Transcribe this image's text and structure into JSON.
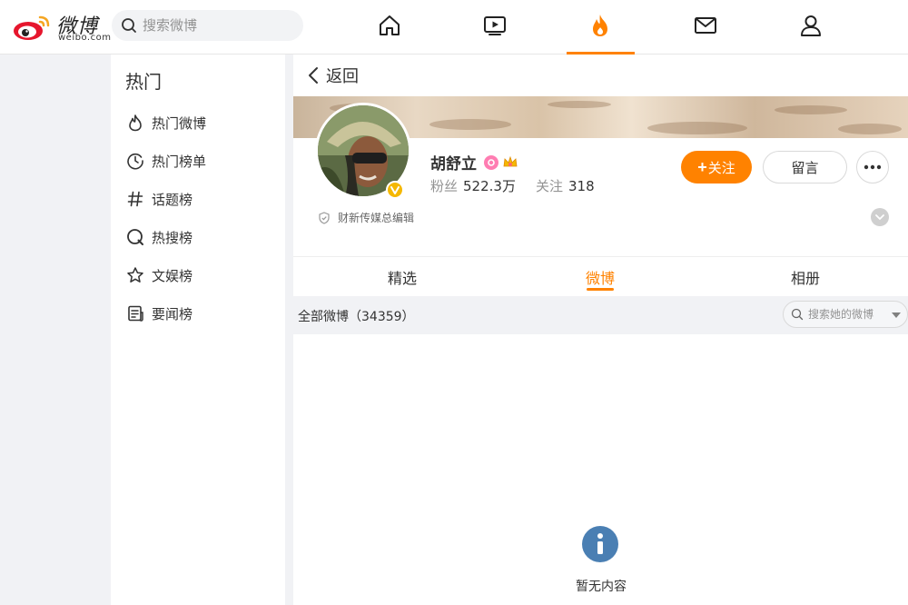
{
  "header": {
    "logo_brand": "微博",
    "logo_domain": "weibo.com",
    "search_placeholder": "搜索微博",
    "nav": [
      {
        "name": "home-icon"
      },
      {
        "name": "video-icon"
      },
      {
        "name": "hot-fire-icon",
        "active": true
      },
      {
        "name": "mail-icon"
      },
      {
        "name": "profile-icon"
      }
    ]
  },
  "sidebar": {
    "title": "热门",
    "items": [
      {
        "label": "热门微博",
        "icon": "flame-outline-icon"
      },
      {
        "label": "热门榜单",
        "icon": "clock-icon"
      },
      {
        "label": "话题榜",
        "icon": "hashtag-icon"
      },
      {
        "label": "热搜榜",
        "icon": "search-circle-icon"
      },
      {
        "label": "文娱榜",
        "icon": "star-icon"
      },
      {
        "label": "要闻榜",
        "icon": "news-icon"
      }
    ]
  },
  "main": {
    "back_label": "返回",
    "profile": {
      "name": "胡舒立",
      "fans_label": "粉丝",
      "fans_value": "522.3万",
      "following_label": "关注",
      "following_value": "318",
      "follow_button": "关注",
      "message_button": "留言",
      "description": "财新传媒总编辑"
    },
    "tabs": [
      {
        "label": "精选"
      },
      {
        "label": "微博",
        "active": true
      },
      {
        "label": "相册"
      }
    ],
    "all_weibo_label": "全部微博（34359）",
    "her_search_placeholder": "搜索她的微博",
    "empty_text": "暂无内容"
  },
  "colors": {
    "accent": "#ff8200",
    "info_icon": "#4a7fb3",
    "badge_pink": "#ff7db2",
    "verify_gold": "#f5b800"
  }
}
